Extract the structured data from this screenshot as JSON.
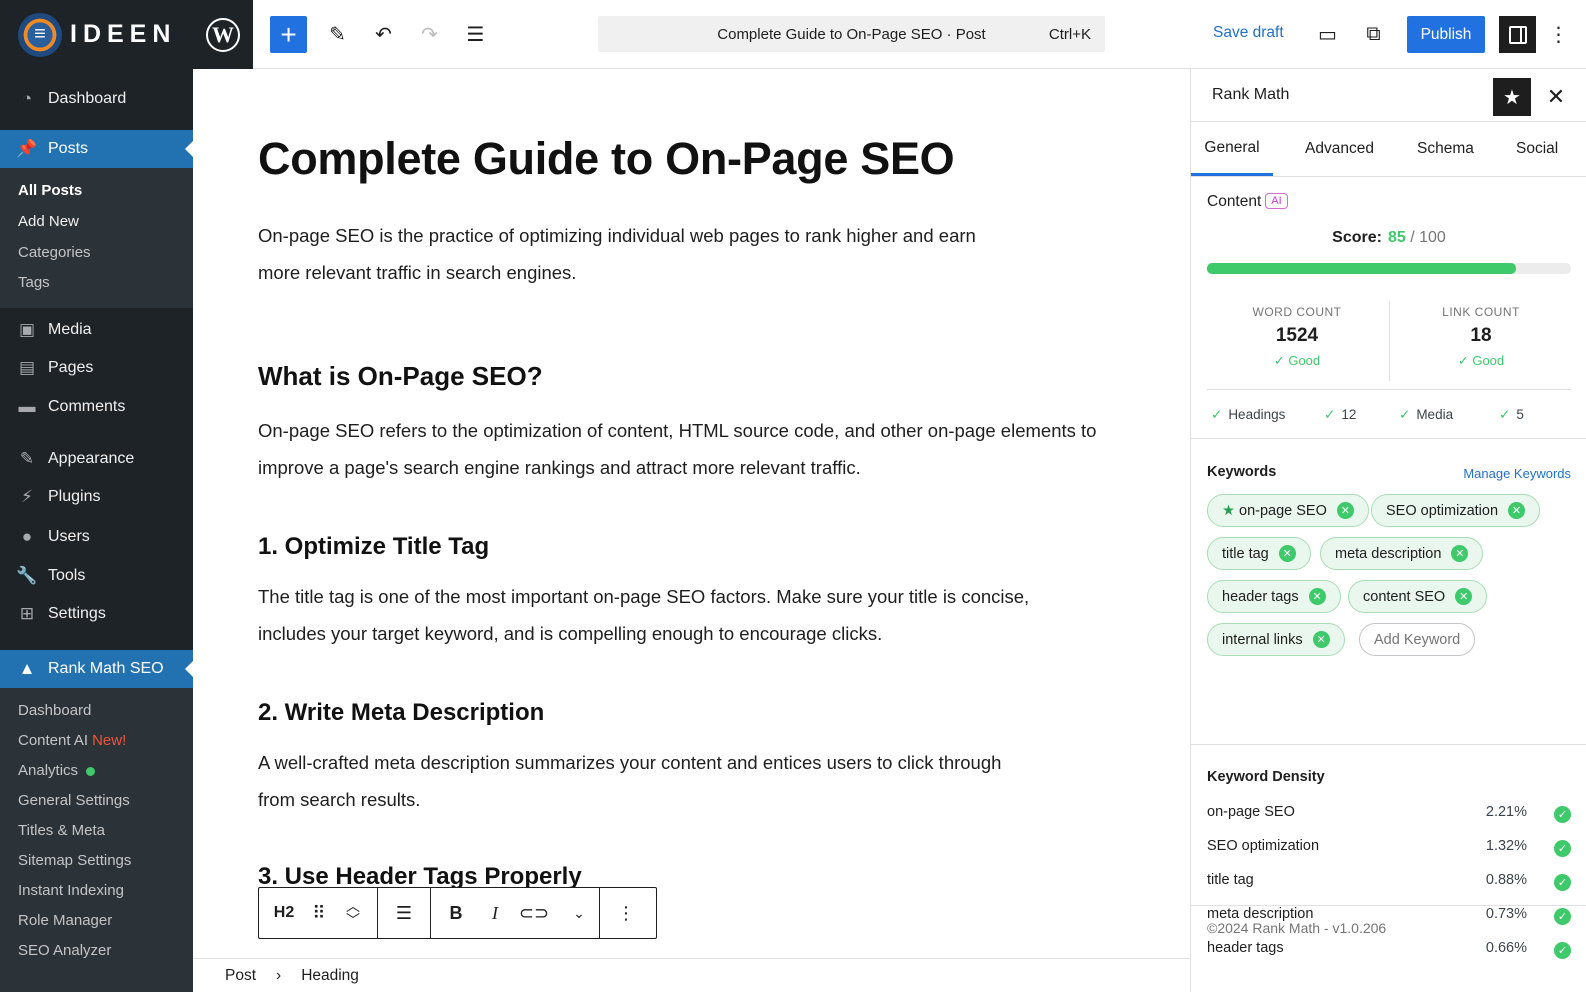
{
  "brand": {
    "name": "IDEEN"
  },
  "sidebar": {
    "items": [
      {
        "label": "Dashboard",
        "icon": "dashboard-icon"
      },
      {
        "label": "Posts",
        "icon": "pin-icon"
      },
      {
        "label": "Media",
        "icon": "media-icon"
      },
      {
        "label": "Pages",
        "icon": "pages-icon"
      },
      {
        "label": "Comments",
        "icon": "comment-icon"
      },
      {
        "label": "Appearance",
        "icon": "brush-icon"
      },
      {
        "label": "Plugins",
        "icon": "plugin-icon"
      },
      {
        "label": "Users",
        "icon": "user-icon"
      },
      {
        "label": "Tools",
        "icon": "wrench-icon"
      },
      {
        "label": "Settings",
        "icon": "settings-icon"
      },
      {
        "label": "Rank Math SEO",
        "icon": "chart-icon"
      }
    ],
    "posts_sub": [
      "All Posts",
      "Add New",
      "Categories",
      "Tags"
    ],
    "rankmath_sub": [
      "Dashboard",
      "Content AI",
      "Analytics",
      "General Settings",
      "Titles & Meta",
      "Sitemap Settings",
      "Instant Indexing",
      "Role Manager",
      "SEO Analyzer"
    ],
    "new_badge": "New!"
  },
  "topbar": {
    "command": "Complete Guide to On-Page SEO · Post",
    "shortcut": "Ctrl+K",
    "save_draft": "Save draft",
    "publish": "Publish"
  },
  "post": {
    "title": "Complete Guide to On-Page SEO",
    "intro": "On-page SEO is the practice of optimizing individual web pages to rank higher and earn more relevant traffic in search engines.",
    "h_what": "What is On-Page SEO?",
    "p_what": "On-page SEO refers to the optimization of content, HTML source code, and other on-page elements to improve a page's search engine rankings and attract more relevant traffic.",
    "h1": "1. Optimize Title Tag",
    "p1": "The title tag is one of the most important on-page SEO factors. Make sure your title is concise, includes your target keyword, and is compelling enough to encourage clicks.",
    "h2": "2. Write Meta Description",
    "p2": "A well-crafted meta description summarizes your content and entices users to click through from search results.",
    "h3": "3. Use Header Tags Properly"
  },
  "block_toolbar": {
    "type": "H2"
  },
  "breadcrumb": {
    "root": "Post",
    "sep": "›",
    "current": "Heading"
  },
  "panel": {
    "title": "Rank Math",
    "tabs": [
      "General",
      "Advanced",
      "Schema",
      "Social"
    ],
    "content_label": "Content",
    "ai_badge": "AI",
    "score_label": "Score:",
    "score": "85",
    "score_max": "/ 100",
    "score_fraction": 0.85,
    "word_count_label": "WORD COUNT",
    "word_count": "1524",
    "word_status": "Good",
    "link_count_label": "LINK COUNT",
    "link_count": "18",
    "link_status": "Good",
    "checks": [
      "Headings",
      "12",
      "Media",
      "5"
    ],
    "keywords_title": "Keywords",
    "manage_keywords": "Manage Keywords",
    "keywords": [
      "on-page SEO",
      "SEO optimization",
      "title tag",
      "meta description",
      "header tags",
      "content SEO",
      "internal links"
    ],
    "add_keyword": "Add Keyword",
    "density_title": "Keyword Density",
    "density": [
      {
        "kw": "on-page SEO",
        "pct": "2.21%"
      },
      {
        "kw": "SEO optimization",
        "pct": "1.32%"
      },
      {
        "kw": "title tag",
        "pct": "0.88%"
      },
      {
        "kw": "meta description",
        "pct": "0.73%"
      },
      {
        "kw": "header tags",
        "pct": "0.66%"
      }
    ],
    "footer": "©2024 Rank Math - v1.0.206"
  },
  "colors": {
    "accent": "#2271e0",
    "success": "#3ec96b",
    "sidebar": "#1d2327"
  }
}
